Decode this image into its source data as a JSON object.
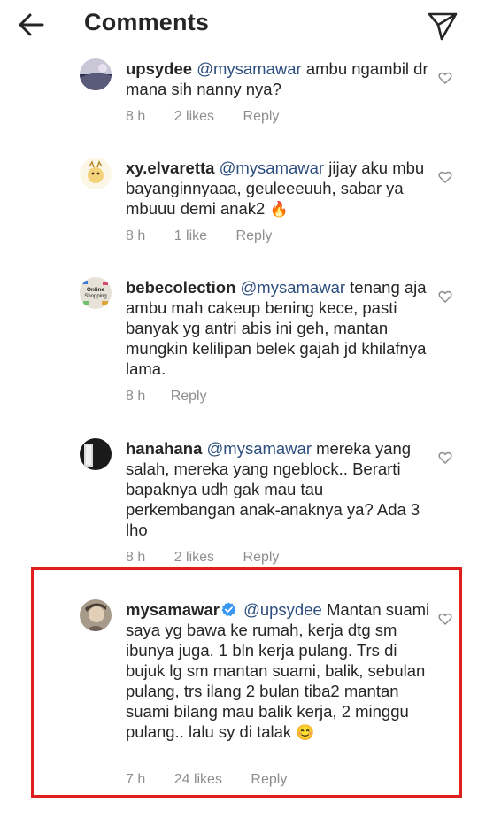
{
  "header": {
    "title": "Comments"
  },
  "comments": [
    {
      "username": "upsydee",
      "mention": "@mysamawar",
      "text": " ambu ngambil dr mana sih nanny nya?",
      "time": "8 h",
      "likes": "2 likes",
      "reply": "Reply"
    },
    {
      "username": "xy.elvaretta",
      "mention": "@mysamawar",
      "text": " jijay aku mbu bayanginnyaaa, geuleeeuuh, sabar ya mbuuu demi anak2",
      "emoji": "🔥",
      "time": "8 h",
      "likes": "1 like",
      "reply": "Reply"
    },
    {
      "username": "bebecolection",
      "mention": "@mysamawar",
      "text": " tenang aja ambu mah cakeup bening kece, pasti banyak yg antri abis ini geh, mantan mungkin kelilipan belek gajah jd khilafnya lama.",
      "time": "8 h",
      "reply": "Reply",
      "avatar_text": [
        "Online",
        "Shopping"
      ]
    },
    {
      "username": "hanahana",
      "mention": "@mysamawar",
      "text": " mereka yang salah, mereka yang ngeblock.. Berarti bapaknya udh gak mau tau perkembangan anak-anaknya ya? Ada 3 lho",
      "time": "8 h",
      "likes": "2 likes",
      "reply": "Reply"
    },
    {
      "username": "mysamawar",
      "mention": "@upsydee",
      "text": " Mantan suami saya yg bawa ke rumah, kerja dtg sm ibunya juga. 1 bln kerja pulang. Trs di bujuk lg sm mantan suami, balik, sebulan pulang, trs ilang 2 bulan tiba2 mantan suami bilang mau balik kerja, 2 minggu pulang.. lalu sy di talak",
      "emoji": "😊",
      "time": "7 h",
      "likes": "24 likes",
      "reply": "Reply"
    }
  ],
  "colors": {
    "mention": "#2d4e7e",
    "meta": "#8e8e8e",
    "highlight": "#e11d1d",
    "verified": "#3897f0"
  }
}
